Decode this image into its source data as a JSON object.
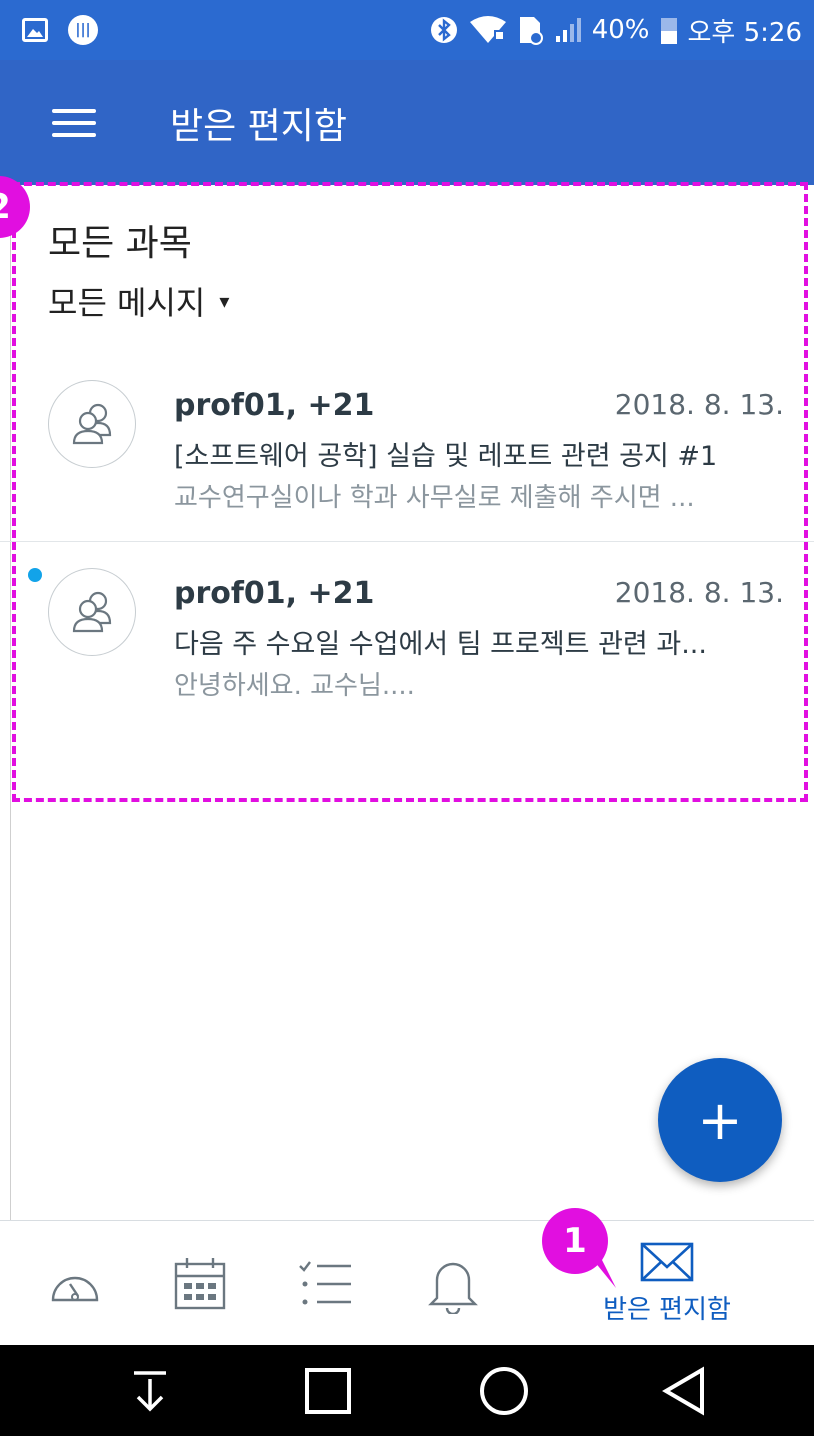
{
  "status_bar": {
    "battery": "40%",
    "time": "오후 5:26"
  },
  "app_bar": {
    "title": "받은 편지함"
  },
  "filters": {
    "course": "모든 과목",
    "message_type": "모든 메시지",
    "caret": "▾"
  },
  "messages": [
    {
      "sender": "prof01, +21",
      "date": "2018. 8. 13.",
      "subject": "[소프트웨어 공학] 실습 및 레포트 관련 공지 #1",
      "preview": "교수연구실이나 학과 사무실로 제출해 주시면 ...",
      "unread": false
    },
    {
      "sender": "prof01, +21",
      "date": "2018. 8. 13.",
      "subject": "다음 주 수요일 수업에서 팀 프로젝트 관련 과...",
      "preview": "안녕하세요. 교수님....",
      "unread": true
    }
  ],
  "fab": {
    "label": "+"
  },
  "bottom_nav": {
    "items": [
      {
        "icon": "dashboard-gauge-icon",
        "label": ""
      },
      {
        "icon": "calendar-icon",
        "label": ""
      },
      {
        "icon": "todo-list-icon",
        "label": ""
      },
      {
        "icon": "notification-bell-icon",
        "label": ""
      },
      {
        "icon": "inbox-envelope-icon",
        "label": "받은 편지함",
        "active": true
      }
    ]
  },
  "annotations": {
    "badge_1": "1",
    "badge_2": "2"
  },
  "colors": {
    "status_bar": "#2b6ad0",
    "app_bar": "#3065c6",
    "accent": "#0f5dc0",
    "unread_dot": "#12a3e9",
    "annotation": "#e10fe0"
  }
}
